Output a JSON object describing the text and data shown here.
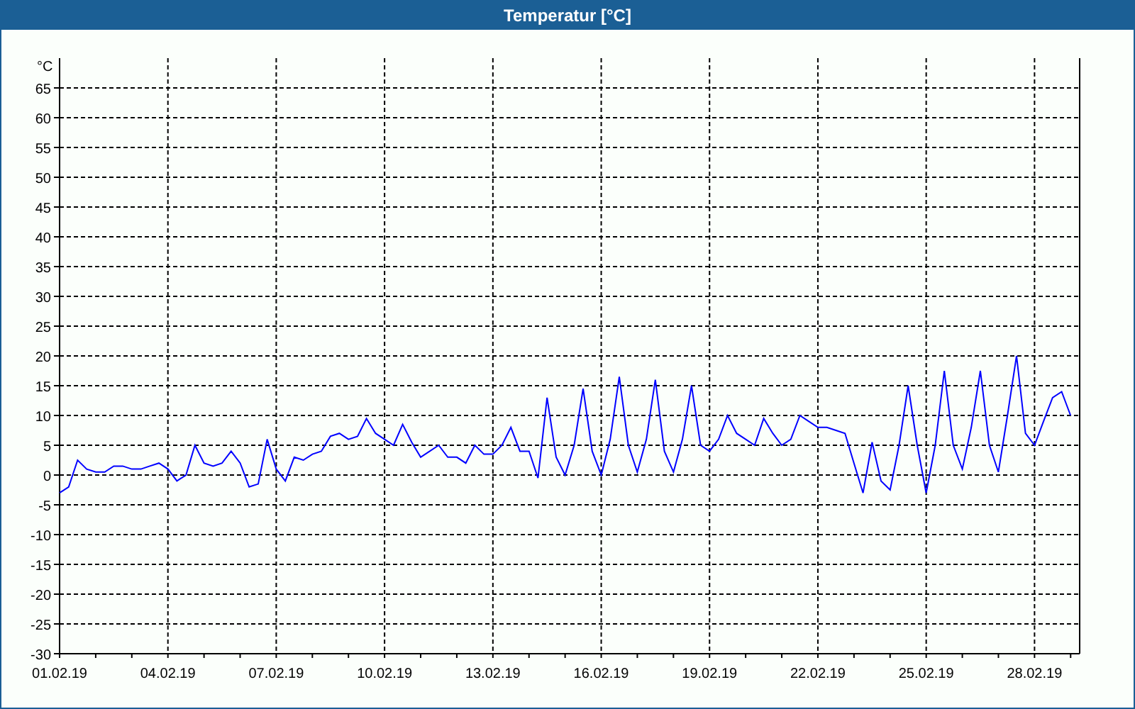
{
  "window": {
    "title": "Temperatur [°C]"
  },
  "chart": {
    "chart_data": {
      "type": "line",
      "grid": true,
      "ylabel": "°C",
      "ylim": [
        -30,
        70
      ],
      "yticks": [
        -30,
        -25,
        -20,
        -15,
        -10,
        -5,
        0,
        5,
        10,
        15,
        20,
        25,
        30,
        35,
        40,
        45,
        50,
        55,
        60,
        65
      ],
      "categories": [
        "01.02.19",
        null,
        null,
        null,
        null,
        null,
        null,
        null,
        null,
        null,
        null,
        null,
        "04.02.19",
        null,
        null,
        null,
        null,
        null,
        null,
        null,
        null,
        null,
        null,
        null,
        "07.02.19",
        null,
        null,
        null,
        null,
        null,
        null,
        null,
        null,
        null,
        null,
        null,
        "10.02.19",
        null,
        null,
        null,
        null,
        null,
        null,
        null,
        null,
        null,
        null,
        null,
        "13.02.19",
        null,
        null,
        null,
        null,
        null,
        null,
        null,
        null,
        null,
        null,
        null,
        "16.02.19",
        null,
        null,
        null,
        null,
        null,
        null,
        null,
        null,
        null,
        null,
        null,
        "19.02.19",
        null,
        null,
        null,
        null,
        null,
        null,
        null,
        null,
        null,
        null,
        null,
        "22.02.19",
        null,
        null,
        null,
        null,
        null,
        null,
        null,
        null,
        null,
        null,
        null,
        "25.02.19",
        null,
        null,
        null,
        null,
        null,
        null,
        null,
        null,
        null,
        null,
        null,
        "28.02.19",
        null,
        null,
        null,
        null
      ],
      "series": [
        {
          "color": "#0000ff",
          "values": [
            -3,
            -2,
            2.5,
            1,
            0.5,
            0.5,
            1.5,
            1.5,
            1,
            1,
            1.5,
            2,
            1,
            -1,
            0,
            5,
            2,
            1.5,
            2,
            4,
            2,
            -2,
            -1.5,
            6,
            1,
            -1,
            3,
            2.5,
            3.5,
            4,
            6.5,
            7,
            6,
            6.5,
            9.5,
            7,
            6,
            5,
            8.5,
            5.5,
            3,
            4,
            5,
            3,
            3,
            2,
            5,
            3.5,
            3.5,
            5,
            8,
            4,
            4,
            -0.5,
            13,
            3,
            0,
            5,
            14.5,
            4,
            0,
            6,
            16.5,
            5,
            0.5,
            6,
            16,
            4,
            0.5,
            6,
            15,
            5,
            4,
            6,
            10,
            7,
            6,
            5,
            9.5,
            7,
            5,
            6,
            10,
            9,
            8,
            8,
            7.5,
            7,
            2,
            -3,
            5.5,
            -1,
            -2.5,
            5,
            15,
            5,
            -3,
            5,
            17.5,
            5,
            1,
            8,
            17.5,
            5,
            0.5,
            10,
            20,
            7,
            5,
            9,
            13,
            14,
            10
          ]
        }
      ]
    }
  }
}
